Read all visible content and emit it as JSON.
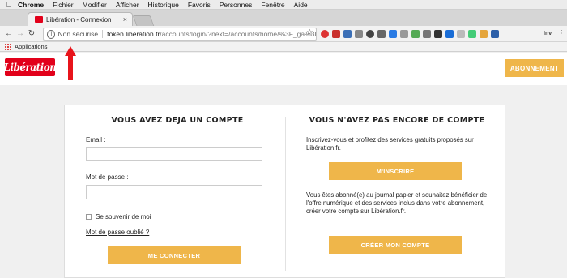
{
  "menubar": {
    "app": "Chrome",
    "items": [
      "Fichier",
      "Modifier",
      "Afficher",
      "Historique",
      "Favoris",
      "Personnes",
      "Fenêtre",
      "Aide"
    ]
  },
  "tab": {
    "title": "Libération - Connexion"
  },
  "omnibox": {
    "security": "Non sécurisé",
    "domain": "token.liberation.fr",
    "path": "/accounts/login/?next=/accounts/home/%3F_ga%3D2..."
  },
  "extensions": {
    "label": "Inv"
  },
  "bookmarks": {
    "apps_label": "Applications"
  },
  "site": {
    "logo_text": "Libération",
    "subscribe_button": "ABONNEMENT"
  },
  "login": {
    "title": "VOUS AVEZ DEJA UN COMPTE",
    "email_label": "Email :",
    "email_value": "",
    "password_label": "Mot de passe :",
    "password_value": "",
    "remember_label": "Se souvenir de moi",
    "forgot_link": "Mot de passe oublié ?",
    "submit_button": "ME CONNECTER"
  },
  "register": {
    "title": "VOUS N'AVEZ PAS ENCORE DE COMPTE",
    "intro": "Inscrivez-vous et profitez des services gratuits proposés sur Libération.fr.",
    "register_button": "M'INSCRIRE",
    "subscriber_text": "Vous êtes abonné(e) au journal papier et souhaitez bénéficier de l'offre numérique et des services inclus dans votre abonnement, créer votre compte sur Libération.fr.",
    "create_button": "CRÉER MON COMPTE"
  },
  "colors": {
    "accent": "#efb64a",
    "brand_red": "#e2001a",
    "annotation_arrow": "#e8141b"
  }
}
